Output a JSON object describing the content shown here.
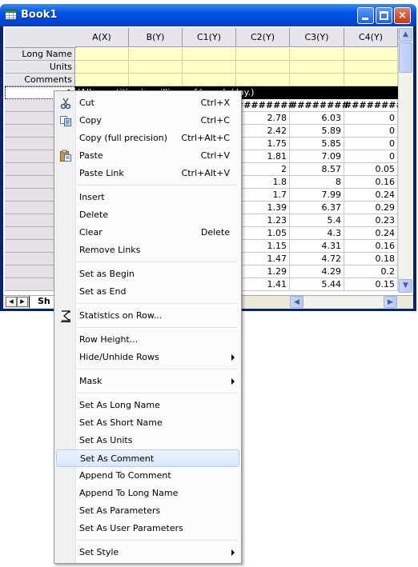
{
  "window": {
    "title": "Book1",
    "accent": "#0055e5",
    "buttons": {
      "minimize": "minimize",
      "maximize": "maximize",
      "close": "×"
    }
  },
  "columns": [
    "A(X)",
    "B(Y)",
    "C1(Y)",
    "C2(Y)",
    "C3(Y)",
    "C4(Y)"
  ],
  "meta_rows": [
    "Long Name",
    "Units",
    "Comments"
  ],
  "comment_row": {
    "number": "1",
    "text": "(All quantities in millions of barrels/day.)"
  },
  "hash_row": [
    "########",
    "########",
    "########"
  ],
  "data_rows": [
    [
      "2.78",
      "6.03",
      "0"
    ],
    [
      "2.42",
      "5.89",
      "0"
    ],
    [
      "1.75",
      "5.85",
      "0"
    ],
    [
      "1.81",
      "7.09",
      "0"
    ],
    [
      "2",
      "8.57",
      "0.05"
    ],
    [
      "1.8",
      "8",
      "0.16"
    ],
    [
      "1.7",
      "7.99",
      "0.24"
    ],
    [
      "1.39",
      "6.37",
      "0.29"
    ],
    [
      "1.23",
      "5.4",
      "0.23"
    ],
    [
      "1.05",
      "4.3",
      "0.24"
    ],
    [
      "1.15",
      "4.31",
      "0.16"
    ],
    [
      "1.47",
      "4.72",
      "0.18"
    ],
    [
      "1.29",
      "4.29",
      "0.2"
    ],
    [
      "1.41",
      "5.44",
      "0.15"
    ]
  ],
  "sheet_tab": "Sh",
  "context_menu": {
    "items": [
      {
        "label": "Cut",
        "shortcut": "Ctrl+X",
        "icon": "scissors-icon"
      },
      {
        "label": "Copy",
        "shortcut": "Ctrl+C",
        "icon": "copy-icon"
      },
      {
        "label": "Copy (full precision)",
        "shortcut": "Ctrl+Alt+C"
      },
      {
        "label": "Paste",
        "shortcut": "Ctrl+V",
        "icon": "paste-icon"
      },
      {
        "label": "Paste Link",
        "shortcut": "Ctrl+Alt+V"
      },
      {
        "label": "Insert"
      },
      {
        "label": "Delete"
      },
      {
        "label": "Clear",
        "shortcut": "Delete"
      },
      {
        "label": "Remove Links"
      },
      {
        "label": "Set as Begin"
      },
      {
        "label": "Set as End"
      },
      {
        "label": "Statistics on Row...",
        "icon": "sigma-icon"
      },
      {
        "label": "Row Height..."
      },
      {
        "label": "Hide/Unhide Rows",
        "submenu": true
      },
      {
        "label": "Mask",
        "submenu": true
      },
      {
        "label": "Set As Long Name"
      },
      {
        "label": "Set As Short Name"
      },
      {
        "label": "Set As Units"
      },
      {
        "label": "Set As Comment",
        "highlighted": true
      },
      {
        "label": "Append To Comment"
      },
      {
        "label": "Append To Long Name"
      },
      {
        "label": "Set As Parameters"
      },
      {
        "label": "Set As User Parameters"
      },
      {
        "label": "Set Style",
        "submenu": true
      }
    ]
  }
}
